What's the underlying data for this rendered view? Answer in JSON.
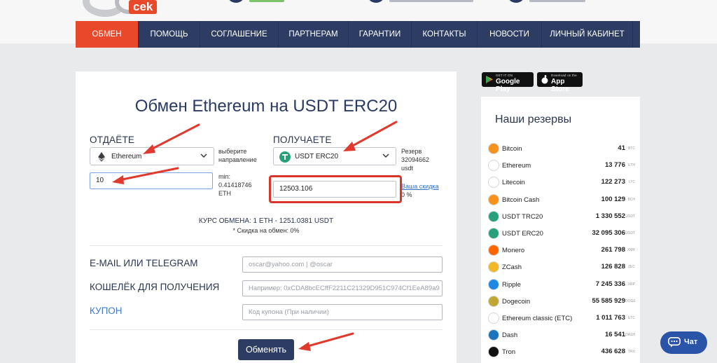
{
  "header": {
    "logo_text": "cek"
  },
  "nav": {
    "items": [
      {
        "label": "ОБМЕН",
        "active": true
      },
      {
        "label": "ПОМОЩЬ"
      },
      {
        "label": "СОГЛАШЕНИЕ"
      },
      {
        "label": "ПАРТНЕРАМ"
      },
      {
        "label": "ГАРАНТИИ"
      },
      {
        "label": "КОНТАКТЫ"
      },
      {
        "label": "НОВОСТИ"
      },
      {
        "label": "ЛИЧНЫЙ КАБИНЕТ"
      }
    ]
  },
  "exchange": {
    "title": "Обмен Ethereum на USDT ERC20",
    "give": {
      "label": "ОТДАЁТЕ",
      "currency": "Ethereum",
      "hint": [
        "выберите",
        "направление"
      ],
      "amount": "10",
      "min": [
        "min:",
        "0.41418746",
        "ETH"
      ]
    },
    "get": {
      "label": "ПОЛУЧАЕТЕ",
      "currency": "USDT ERC20",
      "reserve": [
        "Резерв",
        "32094662",
        "usdt"
      ],
      "amount": "12503.106",
      "discount_link": "Ваша скидка",
      "discount_value": "0 %"
    },
    "rate": "КУРС ОБМЕНА: 1 ETH - 1251.0381 USDT",
    "discount_note": "* Скидка на обмен: 0%",
    "fields": {
      "email_label": "E-MAIL ИЛИ TELEGRAM",
      "email_placeholder": "oscar@yahoo.com | @oscar",
      "wallet_label": "КОШЕЛЁК ДЛЯ ПОЛУЧЕНИЯ",
      "wallet_placeholder": "Например: 0xCDA8bcECffF2211C21329D951C974Cf1EeA89a9",
      "coupon_label": "КУПОН",
      "coupon_placeholder": "Код купона (При наличии)"
    },
    "submit": "Обменять"
  },
  "stores": {
    "google": {
      "small": "GET IT ON",
      "big": "Google Play"
    },
    "apple": {
      "small": "Download on the",
      "big": "App Store"
    }
  },
  "reserves": {
    "title": "Наши резервы",
    "items": [
      {
        "name": "Bitcoin",
        "amount": "41",
        "unit": "BTC",
        "icon": "bitcoin-icon",
        "color": "#f7931a"
      },
      {
        "name": "Ethereum",
        "amount": "13 776",
        "unit": "ETH",
        "icon": "ethereum-icon",
        "color": "#ffffff"
      },
      {
        "name": "Litecoin",
        "amount": "122 273",
        "unit": "LTC",
        "icon": "litecoin-icon",
        "color": "#ffffff"
      },
      {
        "name": "Bitcoin Cash",
        "amount": "100 129",
        "unit": "BCH",
        "icon": "bitcoin-cash-icon",
        "color": "#f7931a"
      },
      {
        "name": "USDT TRC20",
        "amount": "1 330 552",
        "unit": "USDT",
        "icon": "tether-icon",
        "color": "#26a17b"
      },
      {
        "name": "USDT ERC20",
        "amount": "32 095 306",
        "unit": "USDT",
        "icon": "tether-icon",
        "color": "#26a17b"
      },
      {
        "name": "Monero",
        "amount": "261 798",
        "unit": "XMR",
        "icon": "monero-icon",
        "color": "#ff6600"
      },
      {
        "name": "ZCash",
        "amount": "126 828",
        "unit": "ZEC",
        "icon": "zcash-icon",
        "color": "#f4b728"
      },
      {
        "name": "Ripple",
        "amount": "7 245 336",
        "unit": "XRP",
        "icon": "ripple-icon",
        "color": "#1e88e5"
      },
      {
        "name": "Dogecoin",
        "amount": "55 585 929",
        "unit": "DOGE",
        "icon": "dogecoin-icon",
        "color": "#c2a633"
      },
      {
        "name": "Ethereum classic (ETC)",
        "amount": "1 011 763",
        "unit": "ETC",
        "icon": "ethereum-classic-icon",
        "color": "#ffffff"
      },
      {
        "name": "Dash",
        "amount": "16 541",
        "unit": "DASH",
        "icon": "dash-icon",
        "color": "#1c75bc"
      },
      {
        "name": "Tron",
        "amount": "436 628",
        "unit": "TRX",
        "icon": "tron-icon",
        "color": "#111111"
      }
    ]
  },
  "chat": {
    "label": "Чат"
  }
}
